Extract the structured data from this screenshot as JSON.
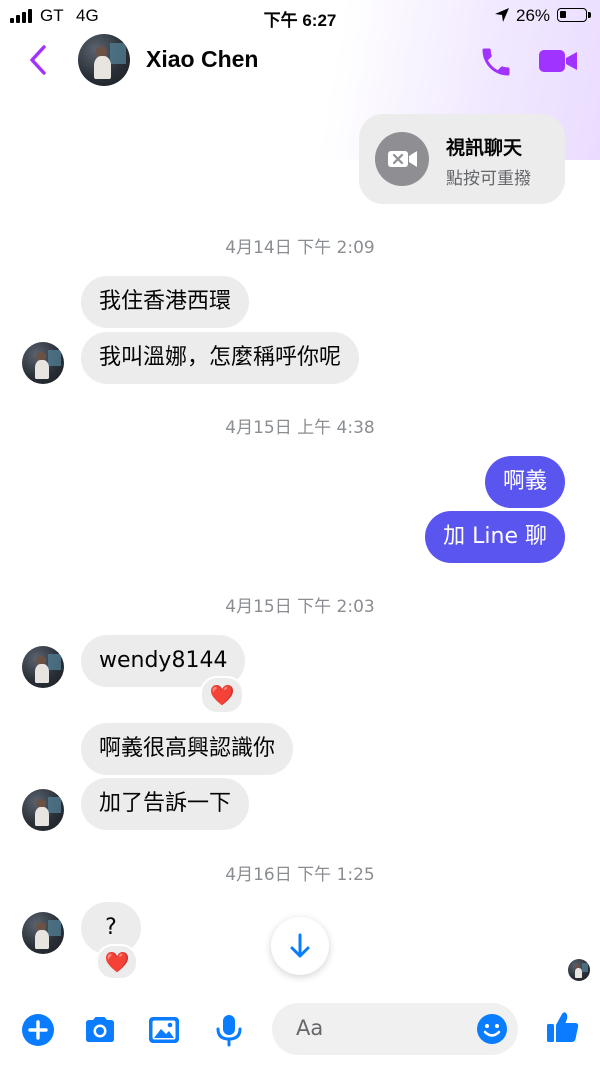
{
  "status_bar": {
    "carrier": "GT",
    "network": "4G",
    "time": "下午 6:27",
    "battery": "26%"
  },
  "header": {
    "contact_name": "Xiao Chen"
  },
  "call_card": {
    "title": "視訊聊天",
    "subtitle": "點按可重撥"
  },
  "messages": {
    "ts1": "4月14日 下午 2:09",
    "m1": "我住香港西環",
    "m2": "我叫溫娜，怎麼稱呼你呢",
    "ts2": "4月15日 上午 4:38",
    "m3": "啊義",
    "m4": "加 Line 聊",
    "ts3": "4月15日 下午 2:03",
    "m5": "wendy8144",
    "m5_reaction": "❤️",
    "m6": "啊義很高興認識你",
    "m7": "加了告訴一下",
    "ts4": "4月16日 下午 1:25",
    "m8": "?",
    "m8_reaction": "❤️"
  },
  "composer": {
    "placeholder": "Aa"
  },
  "colors": {
    "accent": "#a033ff",
    "outgoing_bubble": "#5b55f0",
    "incoming_bubble": "#ececec",
    "composer_icon": "#0a7cff"
  }
}
